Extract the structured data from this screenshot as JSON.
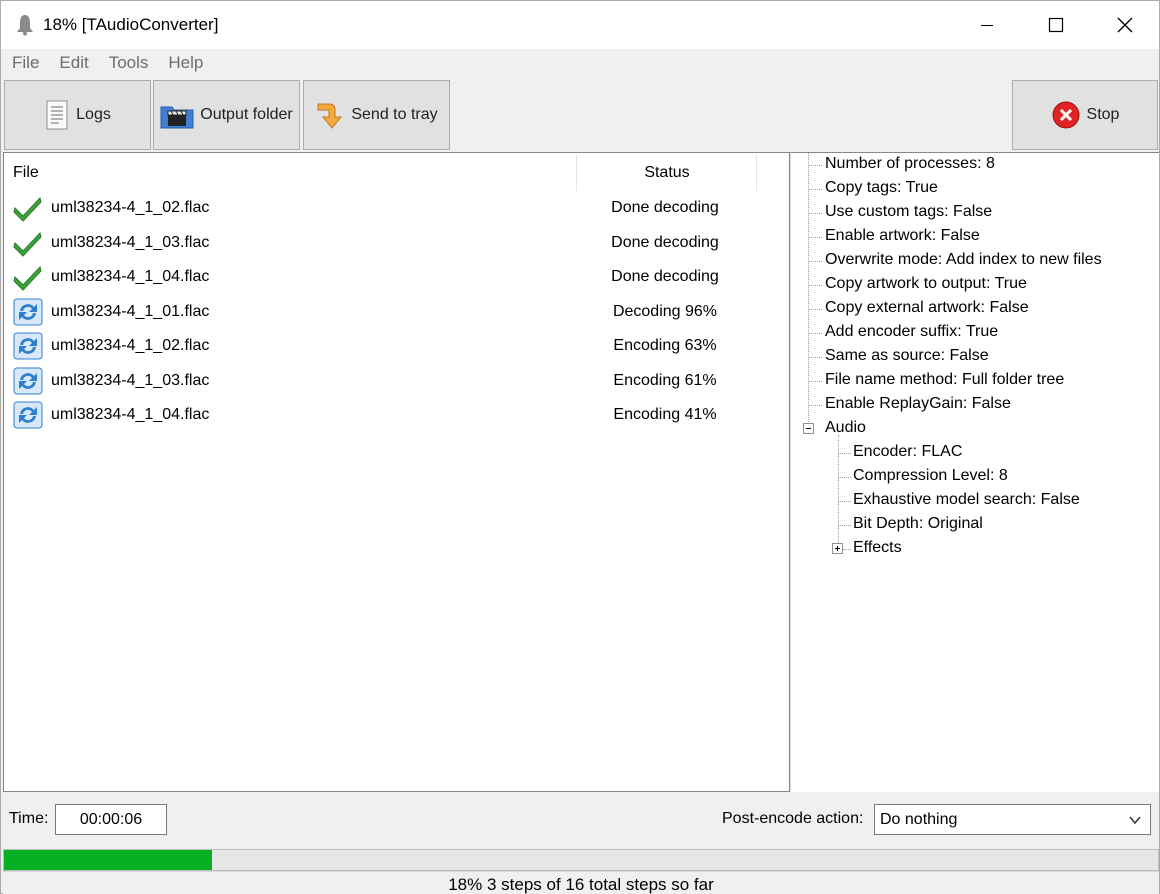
{
  "window": {
    "title": "18% [TAudioConverter]"
  },
  "menu": [
    "File",
    "Edit",
    "Tools",
    "Help"
  ],
  "toolbar": {
    "logs": "Logs",
    "output_folder": "Output folder",
    "send_to_tray": "Send to tray",
    "stop": "Stop"
  },
  "filelist": {
    "headers": {
      "file": "File",
      "status": "Status"
    },
    "rows": [
      {
        "icon": "check-icon",
        "name": "uml38234-4_1_02.flac",
        "status": "Done decoding"
      },
      {
        "icon": "check-icon",
        "name": "uml38234-4_1_03.flac",
        "status": "Done decoding"
      },
      {
        "icon": "check-icon",
        "name": "uml38234-4_1_04.flac",
        "status": "Done decoding"
      },
      {
        "icon": "refresh-icon",
        "name": "uml38234-4_1_01.flac",
        "status": "Decoding 96%"
      },
      {
        "icon": "refresh-icon",
        "name": "uml38234-4_1_02.flac",
        "status": "Encoding 63%"
      },
      {
        "icon": "refresh-icon",
        "name": "uml38234-4_1_03.flac",
        "status": "Encoding 61%"
      },
      {
        "icon": "refresh-icon",
        "name": "uml38234-4_1_04.flac",
        "status": "Encoding 41%"
      }
    ]
  },
  "settings": {
    "top": [
      "Number of processes: 8",
      "Copy tags: True",
      "Use custom tags: False",
      "Enable artwork: False",
      "Overwrite mode: Add index to new files",
      "Copy artwork to output: True",
      "Copy external artwork: False",
      "Add encoder suffix: True",
      "Same as source: False",
      "File name method: Full folder tree",
      "Enable ReplayGain: False"
    ],
    "audio_label": "Audio",
    "audio": [
      "Encoder: FLAC",
      "Compression Level: 8",
      "Exhaustive model search: False",
      "Bit Depth: Original"
    ],
    "effects_label": "Effects"
  },
  "bottom": {
    "time_label": "Time:",
    "time_value": "00:00:06",
    "post_label": "Post-encode action:",
    "post_value": "Do nothing"
  },
  "progress": {
    "percent": 18,
    "status_text": "18% 3 steps of 16 total steps so far"
  },
  "colors": {
    "progress": "#06b025",
    "check": "#3aa53a",
    "refresh": "#2f7fd0",
    "stop": "#e02424"
  }
}
